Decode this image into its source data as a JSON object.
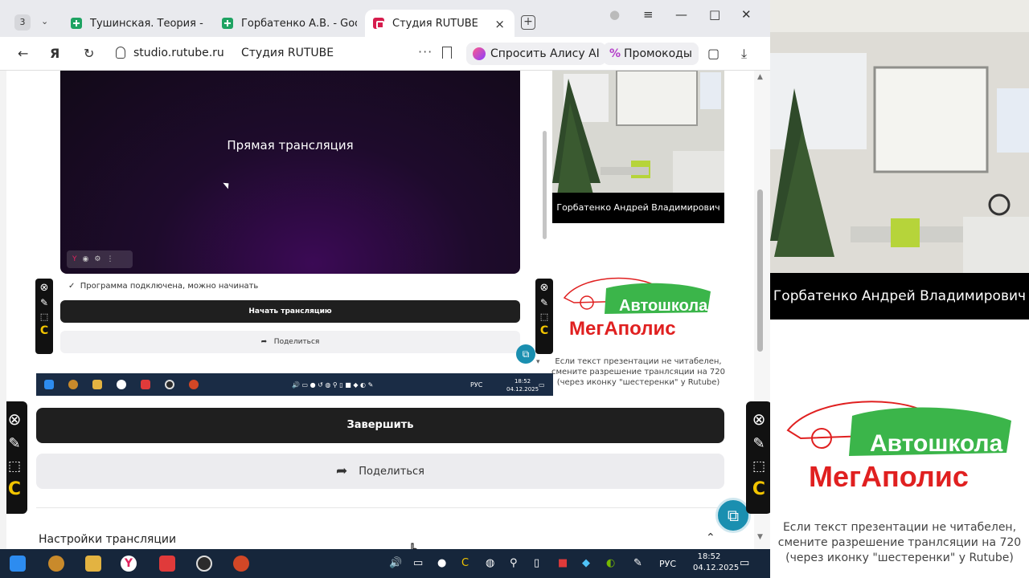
{
  "browser": {
    "tab_count": "3",
    "tabs": [
      {
        "label": "Тушинская. Теория - Goo"
      },
      {
        "label": "Горбатенко А.В. - Google"
      },
      {
        "label": "Студия RUTUBE"
      }
    ],
    "url": "studio.rutube.ru",
    "page_title": "Студия RUTUBE",
    "alice_label": "Спросить Алису AI",
    "promo_label": "Промокоды"
  },
  "capture": {
    "preview_title": "Прямая трансляция",
    "status": "Программа подключена, можно начинать",
    "start_label": "Начать трансляцию",
    "share_label": "Поделиться",
    "camera_name": "Горбатенко Андрей Владимирович",
    "promo_note": "Если текст презентации не читабелен, смените разрешение транлсяции на 720 (через иконку \"шестеренки\" у Rutube)",
    "lang": "РУС",
    "time": "18:52",
    "date": "04.12.2025"
  },
  "main": {
    "finish_label": "Завершить",
    "share_label": "Поделиться",
    "settings_label": "Настройки трансляции"
  },
  "right_panel": {
    "camera_name": "Горбатенко Андрей Владимирович",
    "logo_top": "Автошкола",
    "logo_bottom": "МегАполис",
    "promo_note": "Если текст презентации не читабелен, смените разрешение транлсяции на 720 (через иконку \"шестеренки\" у Rutube)"
  },
  "taskbar": {
    "lang": "РУС",
    "time": "18:52",
    "date": "04.12.2025"
  },
  "colors": {
    "rutube_red": "#d61d4d",
    "dark_button": "#1f1f1f",
    "logo_green": "#3bb54a",
    "logo_red": "#e02020",
    "chat_teal": "#1a8fb0"
  }
}
